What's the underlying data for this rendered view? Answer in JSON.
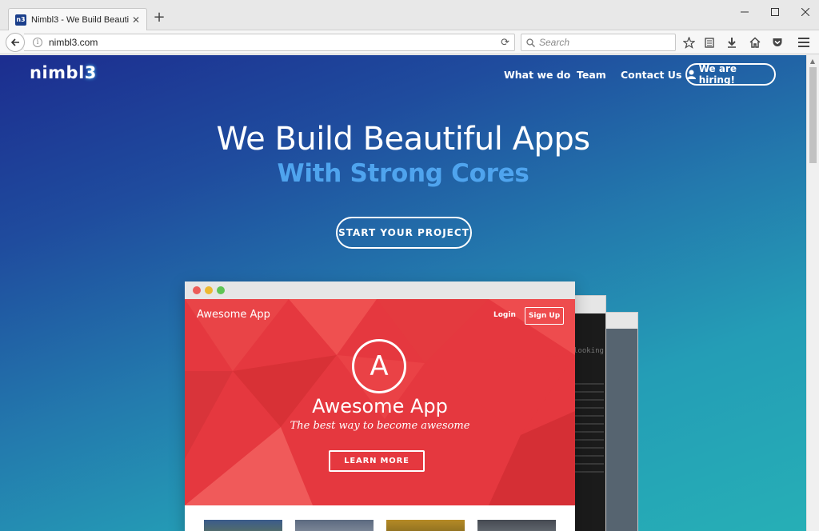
{
  "browser": {
    "tab_title": "Nimbl3 - We Build Beautif...",
    "favicon_text": "n3",
    "url": "nimbl3.com",
    "search_placeholder": "Search"
  },
  "site": {
    "logo_text": "nimbl",
    "logo_suffix": "3",
    "nav": [
      {
        "label": "What we do"
      },
      {
        "label": "Team"
      },
      {
        "label": "Contact Us"
      }
    ],
    "hiring_label": "We are hiring!",
    "hero_title": "We Build Beautiful Apps",
    "hero_subtitle": "With Strong Cores",
    "cta_label": "START YOUR PROJECT"
  },
  "mockup": {
    "app_brand": "Awesome App",
    "login_label": "Login",
    "signup_label": "Sign Up",
    "logo_letter": "A",
    "app_name": "Awesome App",
    "tagline": "The best way to become awesome",
    "learn_more_label": "LEARN MORE",
    "terminal_word": "looking"
  },
  "colors": {
    "accent_blue": "#4fa4ee",
    "mock_red": "#e5383f",
    "gradient_start": "#1c2d8f",
    "gradient_end": "#26afb6"
  }
}
